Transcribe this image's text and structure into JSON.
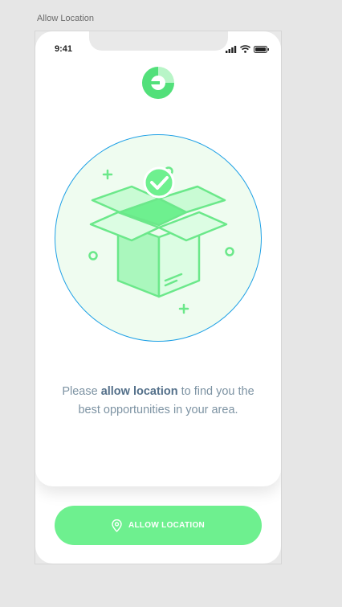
{
  "artboard": {
    "title": "Allow Location"
  },
  "status_bar": {
    "time": "9:41",
    "icons": [
      "signal-icon",
      "wifi-icon",
      "battery-icon"
    ]
  },
  "logo": {
    "icon": "app-logo-icon"
  },
  "illustration": {
    "icon": "open-box-checkmark-icon"
  },
  "message": {
    "before": "Please ",
    "bold": "allow location",
    "after": " to find you the best opportunities in your area."
  },
  "button": {
    "label": "ALLOW LOCATION",
    "icon": "location-pin-icon"
  },
  "colors": {
    "accent": "#6ef08f",
    "illustration_fill": "#effcf0",
    "illustration_stroke": "#6be88a",
    "circle_border": "#1ea0e6",
    "text": "#7d93a3",
    "text_bold": "#54708a",
    "background": "#e6e6e6"
  }
}
